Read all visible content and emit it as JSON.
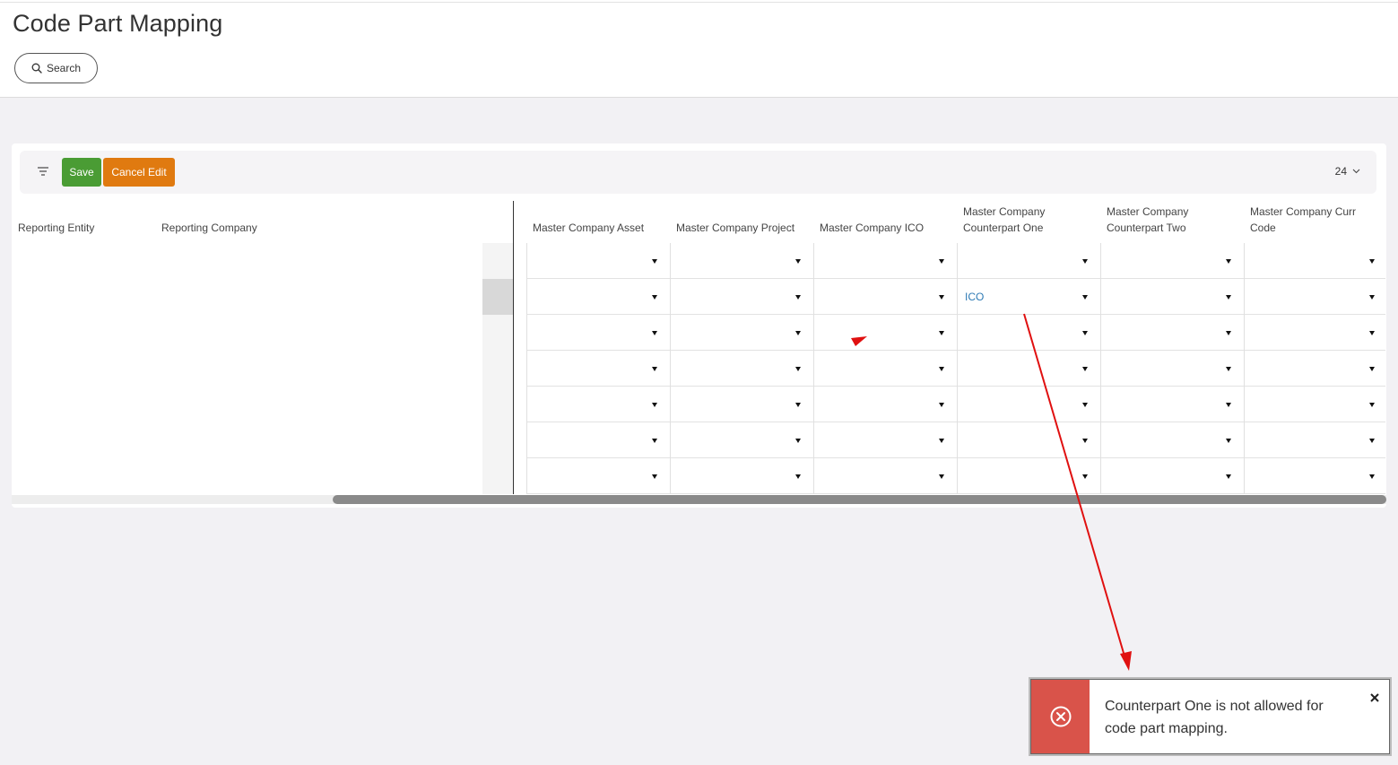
{
  "page": {
    "title": "Code Part Mapping"
  },
  "search": {
    "label": "Search",
    "icon": "search-icon"
  },
  "toolbar": {
    "filter_icon": "filter-icon",
    "save_label": "Save",
    "cancel_label": "Cancel Edit",
    "page_size": "24",
    "colors": {
      "save": "#4a9c34",
      "cancel": "#e07a10"
    }
  },
  "table": {
    "left_columns": [
      "Reporting Entity",
      "Reporting Company"
    ],
    "columns": [
      [
        "Master Company Asset"
      ],
      [
        "Master Company Project"
      ],
      [
        "Master Company ICO"
      ],
      [
        "Master Company",
        "Counterpart One"
      ],
      [
        "Master Company",
        "Counterpart Two"
      ],
      [
        "Master Company Curr",
        "Code"
      ]
    ],
    "rows": [
      [
        "",
        "",
        "",
        "",
        "",
        ""
      ],
      [
        "",
        "",
        "",
        "ICO",
        "",
        ""
      ],
      [
        "",
        "",
        "",
        "",
        "",
        ""
      ],
      [
        "",
        "",
        "",
        "",
        "",
        ""
      ],
      [
        "",
        "",
        "",
        "",
        "",
        ""
      ],
      [
        "",
        "",
        "",
        "",
        "",
        ""
      ],
      [
        "",
        "",
        "",
        "",
        "",
        ""
      ]
    ]
  },
  "toast": {
    "message": "Counterpart One is not allowed for code part mapping.",
    "icon": "error-circle-x-icon",
    "close_icon": "close-icon",
    "color": "#d9534a"
  },
  "annotation": {
    "arrow_color": "#e01010"
  }
}
